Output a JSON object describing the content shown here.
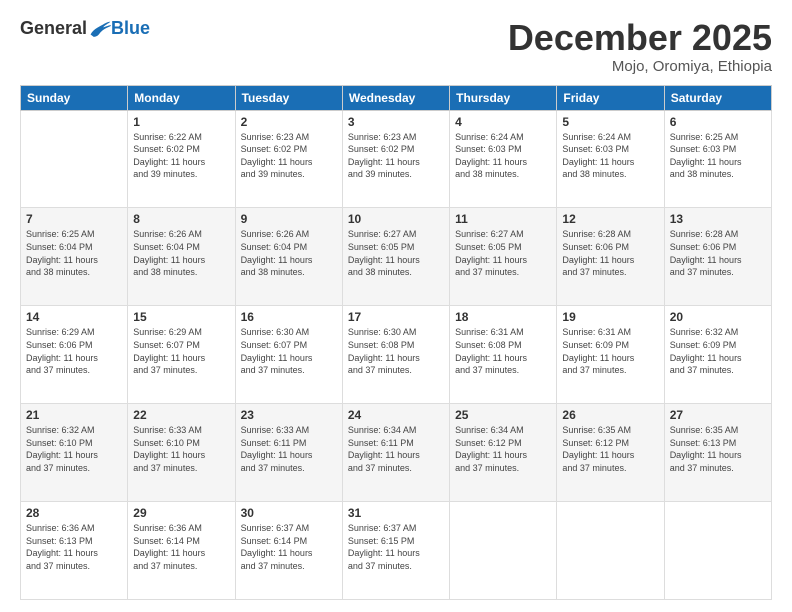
{
  "header": {
    "logo": {
      "general": "General",
      "blue": "Blue"
    },
    "title": "December 2025",
    "location": "Mojo, Oromiya, Ethiopia"
  },
  "calendar": {
    "days_of_week": [
      "Sunday",
      "Monday",
      "Tuesday",
      "Wednesday",
      "Thursday",
      "Friday",
      "Saturday"
    ],
    "weeks": [
      [
        {
          "date": "",
          "info": ""
        },
        {
          "date": "1",
          "info": "Sunrise: 6:22 AM\nSunset: 6:02 PM\nDaylight: 11 hours\nand 39 minutes."
        },
        {
          "date": "2",
          "info": "Sunrise: 6:23 AM\nSunset: 6:02 PM\nDaylight: 11 hours\nand 39 minutes."
        },
        {
          "date": "3",
          "info": "Sunrise: 6:23 AM\nSunset: 6:02 PM\nDaylight: 11 hours\nand 39 minutes."
        },
        {
          "date": "4",
          "info": "Sunrise: 6:24 AM\nSunset: 6:03 PM\nDaylight: 11 hours\nand 38 minutes."
        },
        {
          "date": "5",
          "info": "Sunrise: 6:24 AM\nSunset: 6:03 PM\nDaylight: 11 hours\nand 38 minutes."
        },
        {
          "date": "6",
          "info": "Sunrise: 6:25 AM\nSunset: 6:03 PM\nDaylight: 11 hours\nand 38 minutes."
        }
      ],
      [
        {
          "date": "7",
          "info": "Sunrise: 6:25 AM\nSunset: 6:04 PM\nDaylight: 11 hours\nand 38 minutes."
        },
        {
          "date": "8",
          "info": "Sunrise: 6:26 AM\nSunset: 6:04 PM\nDaylight: 11 hours\nand 38 minutes."
        },
        {
          "date": "9",
          "info": "Sunrise: 6:26 AM\nSunset: 6:04 PM\nDaylight: 11 hours\nand 38 minutes."
        },
        {
          "date": "10",
          "info": "Sunrise: 6:27 AM\nSunset: 6:05 PM\nDaylight: 11 hours\nand 38 minutes."
        },
        {
          "date": "11",
          "info": "Sunrise: 6:27 AM\nSunset: 6:05 PM\nDaylight: 11 hours\nand 37 minutes."
        },
        {
          "date": "12",
          "info": "Sunrise: 6:28 AM\nSunset: 6:06 PM\nDaylight: 11 hours\nand 37 minutes."
        },
        {
          "date": "13",
          "info": "Sunrise: 6:28 AM\nSunset: 6:06 PM\nDaylight: 11 hours\nand 37 minutes."
        }
      ],
      [
        {
          "date": "14",
          "info": "Sunrise: 6:29 AM\nSunset: 6:06 PM\nDaylight: 11 hours\nand 37 minutes."
        },
        {
          "date": "15",
          "info": "Sunrise: 6:29 AM\nSunset: 6:07 PM\nDaylight: 11 hours\nand 37 minutes."
        },
        {
          "date": "16",
          "info": "Sunrise: 6:30 AM\nSunset: 6:07 PM\nDaylight: 11 hours\nand 37 minutes."
        },
        {
          "date": "17",
          "info": "Sunrise: 6:30 AM\nSunset: 6:08 PM\nDaylight: 11 hours\nand 37 minutes."
        },
        {
          "date": "18",
          "info": "Sunrise: 6:31 AM\nSunset: 6:08 PM\nDaylight: 11 hours\nand 37 minutes."
        },
        {
          "date": "19",
          "info": "Sunrise: 6:31 AM\nSunset: 6:09 PM\nDaylight: 11 hours\nand 37 minutes."
        },
        {
          "date": "20",
          "info": "Sunrise: 6:32 AM\nSunset: 6:09 PM\nDaylight: 11 hours\nand 37 minutes."
        }
      ],
      [
        {
          "date": "21",
          "info": "Sunrise: 6:32 AM\nSunset: 6:10 PM\nDaylight: 11 hours\nand 37 minutes."
        },
        {
          "date": "22",
          "info": "Sunrise: 6:33 AM\nSunset: 6:10 PM\nDaylight: 11 hours\nand 37 minutes."
        },
        {
          "date": "23",
          "info": "Sunrise: 6:33 AM\nSunset: 6:11 PM\nDaylight: 11 hours\nand 37 minutes."
        },
        {
          "date": "24",
          "info": "Sunrise: 6:34 AM\nSunset: 6:11 PM\nDaylight: 11 hours\nand 37 minutes."
        },
        {
          "date": "25",
          "info": "Sunrise: 6:34 AM\nSunset: 6:12 PM\nDaylight: 11 hours\nand 37 minutes."
        },
        {
          "date": "26",
          "info": "Sunrise: 6:35 AM\nSunset: 6:12 PM\nDaylight: 11 hours\nand 37 minutes."
        },
        {
          "date": "27",
          "info": "Sunrise: 6:35 AM\nSunset: 6:13 PM\nDaylight: 11 hours\nand 37 minutes."
        }
      ],
      [
        {
          "date": "28",
          "info": "Sunrise: 6:36 AM\nSunset: 6:13 PM\nDaylight: 11 hours\nand 37 minutes."
        },
        {
          "date": "29",
          "info": "Sunrise: 6:36 AM\nSunset: 6:14 PM\nDaylight: 11 hours\nand 37 minutes."
        },
        {
          "date": "30",
          "info": "Sunrise: 6:37 AM\nSunset: 6:14 PM\nDaylight: 11 hours\nand 37 minutes."
        },
        {
          "date": "31",
          "info": "Sunrise: 6:37 AM\nSunset: 6:15 PM\nDaylight: 11 hours\nand 37 minutes."
        },
        {
          "date": "",
          "info": ""
        },
        {
          "date": "",
          "info": ""
        },
        {
          "date": "",
          "info": ""
        }
      ]
    ]
  }
}
